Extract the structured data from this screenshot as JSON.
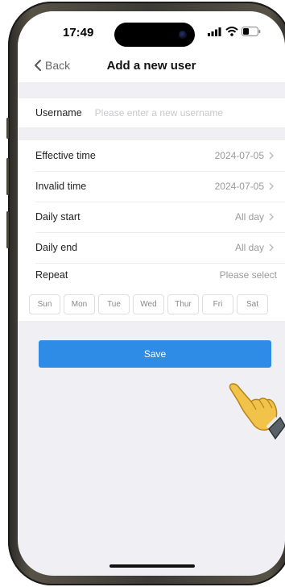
{
  "status_bar": {
    "time": "17:49"
  },
  "nav": {
    "back_label": "Back",
    "title": "Add a new user"
  },
  "form": {
    "username": {
      "label": "Username",
      "placeholder": "Please enter a new username",
      "value": ""
    },
    "effective_time": {
      "label": "Effective time",
      "value": "2024-07-05"
    },
    "invalid_time": {
      "label": "Invalid time",
      "value": "2024-07-05"
    },
    "daily_start": {
      "label": "Daily start",
      "value": "All day"
    },
    "daily_end": {
      "label": "Daily end",
      "value": "All day"
    },
    "repeat": {
      "label": "Repeat",
      "value": "Please select",
      "days": [
        "Sun",
        "Mon",
        "Tue",
        "Wed",
        "Thur",
        "Fri",
        "Sat"
      ]
    }
  },
  "save_label": "Save",
  "colors": {
    "accent": "#2e8ce6",
    "background": "#f0f0f4",
    "hint": "#c8c8cc"
  },
  "icons": [
    "back-chevron-icon",
    "chevron-right-icon",
    "signal-icon",
    "wifi-icon",
    "battery-icon",
    "hand-pointer-icon"
  ]
}
